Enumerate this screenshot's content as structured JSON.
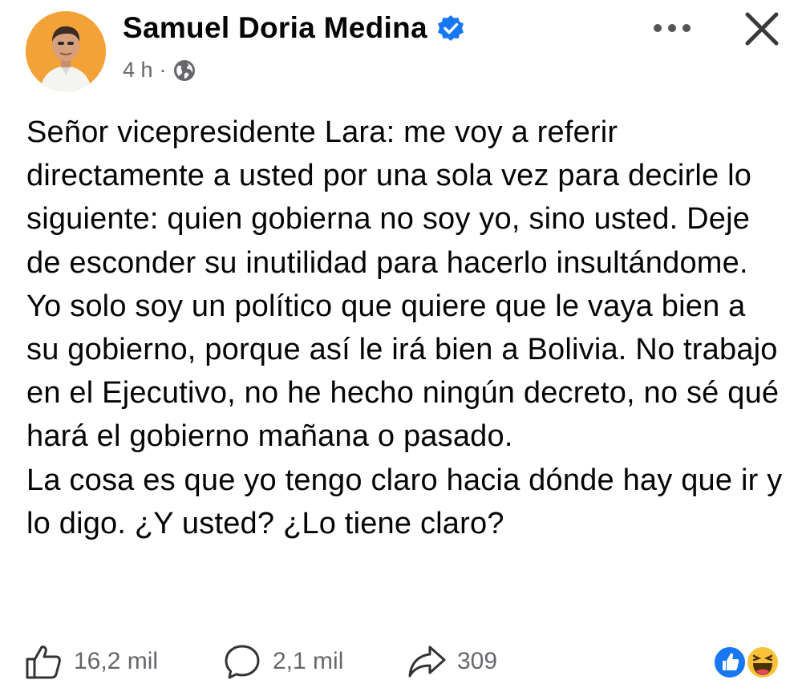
{
  "post": {
    "author": "Samuel Doria Medina",
    "time": "4 h",
    "separator": "·",
    "paragraphs": [
      "Señor vicepresidente Lara: me voy a referir directamente a usted por una sola vez para decirle lo siguiente: quien gobierna no soy yo, sino usted. Deje de esconder su inutilidad para hacerlo insultándome.",
      "Yo solo soy un político que quiere que le vaya bien a su gobierno, porque así le irá bien a Bolivia. No trabajo en el Ejecutivo, no he hecho ningún decreto, no sé qué hará el gobierno mañana o pasado.",
      "La cosa es que yo tengo claro hacia dónde hay que ir y lo digo. ¿Y usted? ¿Lo tiene claro?"
    ]
  },
  "actions": {
    "likes": "16,2 mil",
    "comments": "2,1 mil",
    "shares": "309"
  },
  "icons": {
    "verified": "verified-badge-icon",
    "privacy": "globe-icon",
    "more": "more-options-icon",
    "close": "close-icon",
    "like": "thumbs-up-icon",
    "comment": "comment-bubble-icon",
    "share": "share-arrow-icon",
    "reactions": [
      "like-reaction-icon",
      "haha-reaction-icon"
    ]
  },
  "colors": {
    "verified_blue": "#1877f2",
    "secondary_text": "#65676b",
    "avatar_background": "#f2a236"
  }
}
